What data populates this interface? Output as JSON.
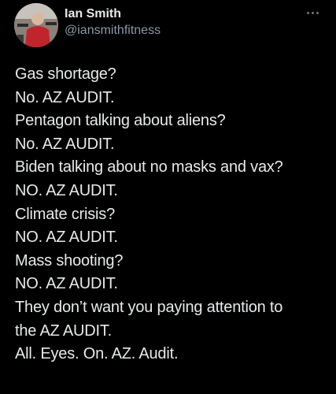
{
  "author": {
    "display_name": "Ian Smith",
    "handle": "@iansmithfitness"
  },
  "menu": {
    "icon": "more-horizontal-icon"
  },
  "tweet": {
    "lines": [
      "Gas shortage?",
      "No. AZ AUDIT.",
      "Pentagon talking about aliens?",
      "No. AZ AUDIT.",
      "Biden talking about no masks and vax?",
      "NO. AZ AUDIT.",
      "Climate crisis?",
      "NO. AZ AUDIT.",
      "Mass shooting?",
      "NO. AZ AUDIT.",
      "They don’t want you paying attention to",
      "the AZ AUDIT.",
      "All. Eyes. On. AZ. Audit."
    ]
  },
  "colors": {
    "background": "#000000",
    "text": "#e7e9ea",
    "secondary_text": "#8b98a5"
  }
}
